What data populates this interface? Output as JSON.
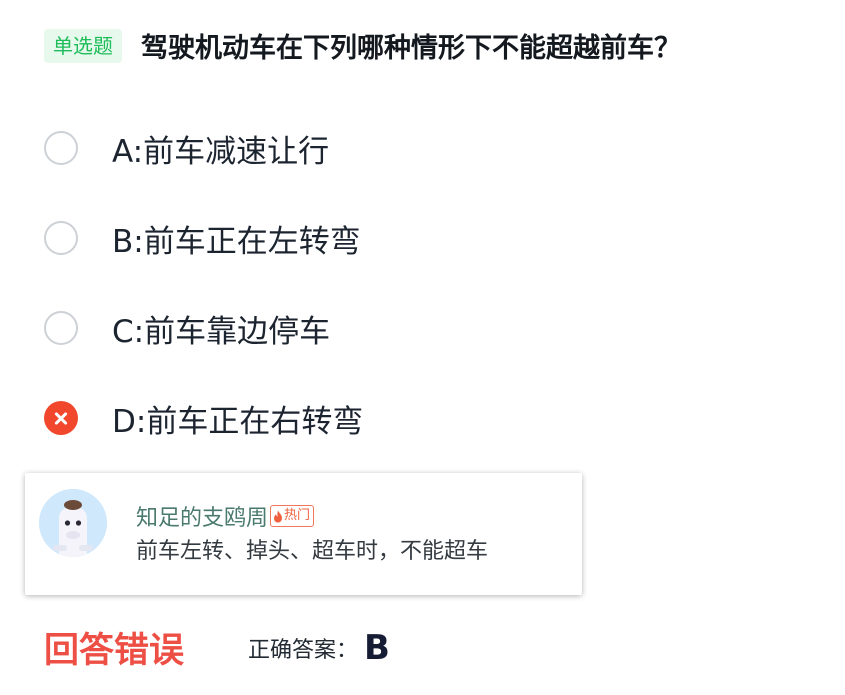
{
  "question": {
    "type_tag": "单选题",
    "text": "驾驶机动车在下列哪种情形下不能超越前车？"
  },
  "options": [
    {
      "label": "A:前车减速让行",
      "state": "unselected"
    },
    {
      "label": "B:前车正在左转弯",
      "state": "unselected"
    },
    {
      "label": "C:前车靠边停车",
      "state": "unselected"
    },
    {
      "label": "D:前车正在右转弯",
      "state": "wrong"
    }
  ],
  "comment": {
    "user_name": "知足的支鸥周",
    "badge": "热门",
    "text": "前车左转、掉头、超车时，不能超车",
    "avatar_icon": "horse-avatar-icon"
  },
  "result": {
    "status": "回答错误",
    "answer_label": "正确答案：",
    "answer_value": "B"
  },
  "colors": {
    "tag_bg": "#e7f8ec",
    "tag_text": "#1fbd5a",
    "wrong_red": "#f1472d",
    "status_red": "#ee4f45",
    "hot_orange": "#f0603f",
    "username_green": "#4a7a6e"
  }
}
